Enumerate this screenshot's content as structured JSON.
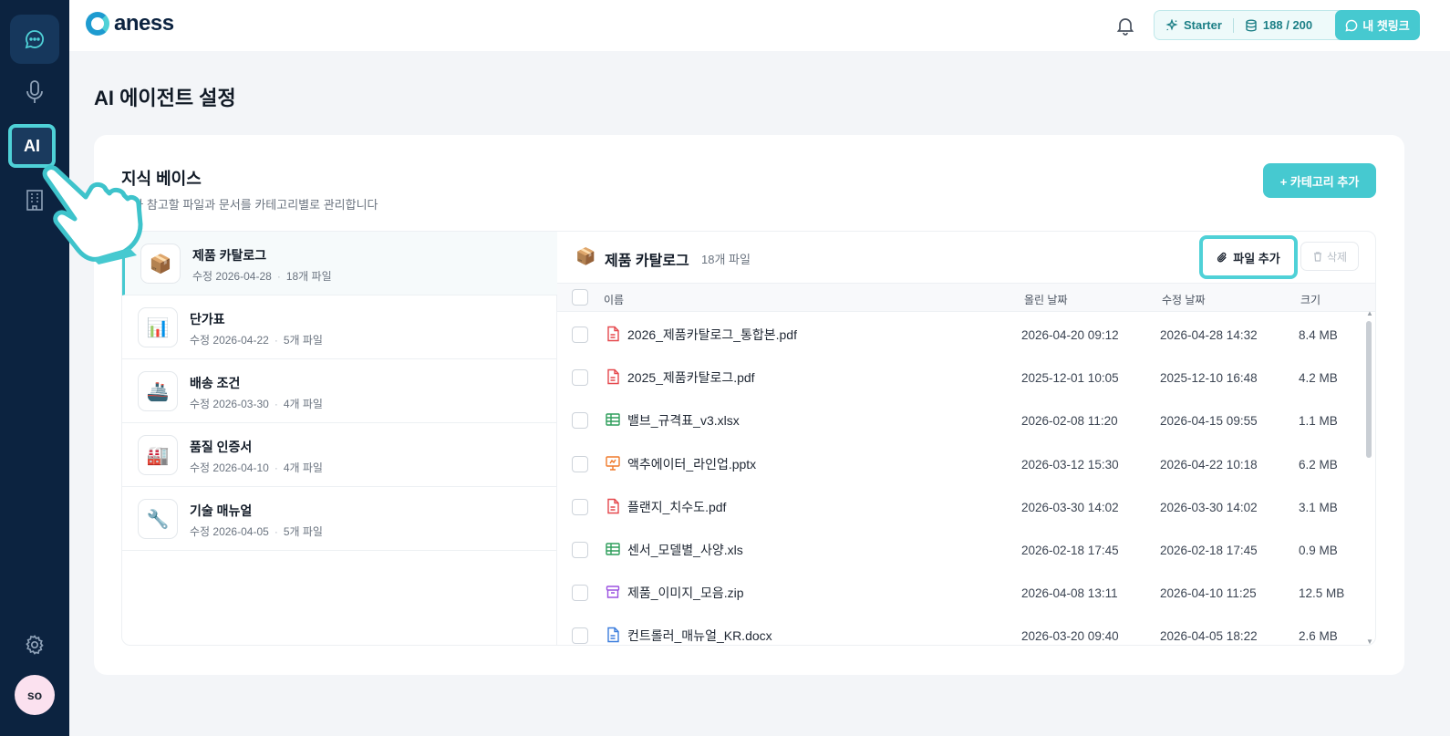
{
  "sidebar": {
    "ai_label": "AI",
    "avatar": "so"
  },
  "header": {
    "logo": "aness",
    "plan": "Starter",
    "usage": "188 / 200",
    "chatlink": "내 챗링크"
  },
  "page": {
    "title": "AI 에이전트 설정"
  },
  "kb": {
    "title": "지식 베이스",
    "subtitle": "AI가 참고할 파일과 문서를 카테고리별로 관리합니다",
    "add_category": "+ 카테고리 추가"
  },
  "categories": [
    {
      "name": "제품 카탈로그",
      "modified": "수정 2026-04-28",
      "count": "18개 파일",
      "icon": "📦"
    },
    {
      "name": "단가표",
      "modified": "수정 2026-04-22",
      "count": "5개 파일",
      "icon": "📊"
    },
    {
      "name": "배송 조건",
      "modified": "수정 2026-03-30",
      "count": "4개 파일",
      "icon": "🚢"
    },
    {
      "name": "품질 인증서",
      "modified": "수정 2026-04-10",
      "count": "4개 파일",
      "icon": "🏭"
    },
    {
      "name": "기술 매뉴얼",
      "modified": "수정 2026-04-05",
      "count": "5개 파일",
      "icon": "🔧"
    }
  ],
  "file_pane": {
    "title": "제품 카탈로그",
    "icon": "📦",
    "count": "18개 파일",
    "add_file": "파일 추가",
    "delete": "삭제",
    "columns": {
      "name": "이름",
      "uploaded": "올린 날짜",
      "modified": "수정 날짜",
      "size": "크기"
    }
  },
  "files": [
    {
      "name": "2026_제품카탈로그_통합본.pdf",
      "type": "pdf",
      "uploaded": "2026-04-20 09:12",
      "modified": "2026-04-28 14:32",
      "size": "8.4 MB"
    },
    {
      "name": "2025_제품카탈로그.pdf",
      "type": "pdf",
      "uploaded": "2025-12-01 10:05",
      "modified": "2025-12-10 16:48",
      "size": "4.2 MB"
    },
    {
      "name": "밸브_규격표_v3.xlsx",
      "type": "sheet",
      "uploaded": "2026-02-08 11:20",
      "modified": "2026-04-15 09:55",
      "size": "1.1 MB"
    },
    {
      "name": "액추에이터_라인업.pptx",
      "type": "slide",
      "uploaded": "2026-03-12 15:30",
      "modified": "2026-04-22 10:18",
      "size": "6.2 MB"
    },
    {
      "name": "플랜지_치수도.pdf",
      "type": "pdf",
      "uploaded": "2026-03-30 14:02",
      "modified": "2026-03-30 14:02",
      "size": "3.1 MB"
    },
    {
      "name": "센서_모델별_사양.xls",
      "type": "sheet",
      "uploaded": "2026-02-18 17:45",
      "modified": "2026-02-18 17:45",
      "size": "0.9 MB"
    },
    {
      "name": "제품_이미지_모음.zip",
      "type": "zip",
      "uploaded": "2026-04-08 13:11",
      "modified": "2026-04-10 11:25",
      "size": "12.5 MB"
    },
    {
      "name": "컨트롤러_매뉴얼_KR.docx",
      "type": "doc",
      "uploaded": "2026-03-20 09:40",
      "modified": "2026-04-05 18:22",
      "size": "2.6 MB"
    }
  ],
  "colors": {
    "accent": "#46c9d0",
    "sidebar": "#0c2340",
    "pdf": "#e5484d",
    "sheet": "#2e9e5b",
    "slide": "#f07a2b",
    "zip": "#9b51e0",
    "doc": "#3b7ddd"
  }
}
